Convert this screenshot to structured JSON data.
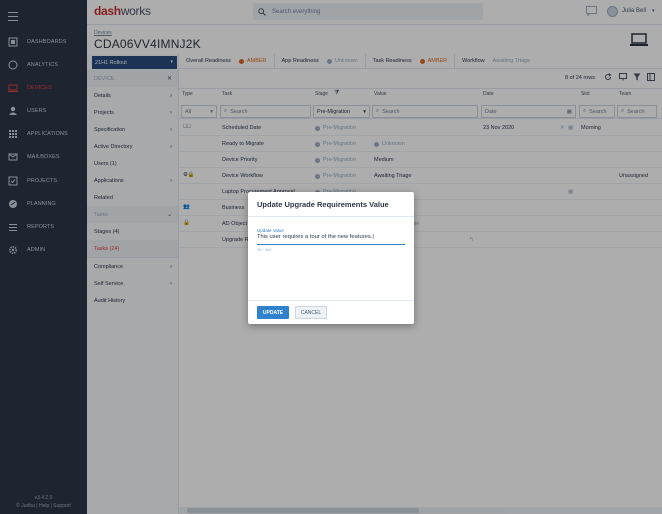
{
  "app": {
    "logo_main": "dash",
    "logo_works": "works"
  },
  "topbar": {
    "search_placeholder": "Search everything",
    "user_name": "Julia Bell"
  },
  "nav": {
    "items": [
      {
        "label": "DASHBOARDS",
        "icon": "dashboard-icon"
      },
      {
        "label": "ANALYTICS",
        "icon": "analytics-icon"
      },
      {
        "label": "DEVICES",
        "icon": "devices-icon"
      },
      {
        "label": "USERS",
        "icon": "user-icon"
      },
      {
        "label": "APPLICATIONS",
        "icon": "apps-icon"
      },
      {
        "label": "MAILBOXES",
        "icon": "mail-icon"
      },
      {
        "label": "PROJECTS",
        "icon": "projects-icon"
      },
      {
        "label": "PLANNING",
        "icon": "planning-icon"
      },
      {
        "label": "REPORTS",
        "icon": "reports-icon"
      },
      {
        "label": "ADMIN",
        "icon": "gear-icon"
      }
    ],
    "version": "v3.4.2.0",
    "footer": "© Juriba | Help | Support"
  },
  "header": {
    "breadcrumb": "Devices",
    "title": "CDA06VV4IMNJ2K"
  },
  "panel": {
    "rollout": "21H1 Rollout",
    "device_header": "DEVICE",
    "items": [
      {
        "label": "Details",
        "arrow": "›"
      },
      {
        "label": "Projects",
        "arrow": "›"
      },
      {
        "label": "Specification",
        "arrow": "›"
      },
      {
        "label": "Active Directory",
        "arrow": "›"
      },
      {
        "label": "Users (1)",
        "arrow": ""
      },
      {
        "label": "Applications",
        "arrow": "›"
      },
      {
        "label": "Related",
        "arrow": ""
      }
    ],
    "tasks_header": "Tasks",
    "task_items": [
      {
        "label": "Stages (4)",
        "arrow": ""
      },
      {
        "label": "Tasks (24)",
        "arrow": ""
      },
      {
        "label": "Compliance",
        "arrow": "›"
      },
      {
        "label": "Self Service",
        "arrow": "›"
      },
      {
        "label": "Audit History",
        "arrow": ""
      }
    ]
  },
  "readiness": {
    "overall_label": "Overall Readiness",
    "overall_status": "AMBER",
    "app_label": "App Readiness",
    "app_status": "Unknown",
    "task_label": "Task Readiness",
    "task_status": "AMBER",
    "workflow_label": "Workflow",
    "workflow_status": "Awaiting Triage"
  },
  "table": {
    "row_count": "8 of 24 rows",
    "columns": {
      "type": "Type",
      "task": "Task",
      "stage": "Stage",
      "value": "Value",
      "date": "Date",
      "slot": "Slot",
      "team": "Team"
    },
    "filters": {
      "type": "All",
      "task": "Search",
      "stage": "Pre-Migration",
      "value": "Search",
      "date": "Date",
      "slot": "Search",
      "team": "Search"
    },
    "rows": [
      {
        "task": "Scheduled Date",
        "stage": "Pre-Migration",
        "value": "",
        "date": "23 Nov 2020",
        "slot": "Morning",
        "team": ""
      },
      {
        "task": "Ready to Migrate",
        "stage": "Pre-Migration",
        "value": "Unknown",
        "date": "",
        "slot": "",
        "team": ""
      },
      {
        "task": "Device Priority",
        "stage": "Pre-Migration",
        "value": "Medium",
        "date": "",
        "slot": "",
        "team": ""
      },
      {
        "task": "Device Workflow",
        "stage": "Pre-Migration",
        "value": "Awaiting Triage",
        "date": "",
        "slot": "",
        "team": "Unassigned"
      },
      {
        "task": "Laptop Procurement Approval",
        "stage": "Pre-Migration",
        "value": "",
        "date": "",
        "slot": "",
        "team": ""
      },
      {
        "task": "Business",
        "stage": "",
        "value": "",
        "date": "",
        "slot": "",
        "team": ""
      },
      {
        "task": "AD Object",
        "stage": "",
        "value": "ble",
        "date": "",
        "slot": "",
        "team": ""
      },
      {
        "task": "Upgrade R",
        "stage": "",
        "value": "",
        "date": "",
        "slot": "",
        "team": ""
      }
    ]
  },
  "dialog": {
    "title": "Update Upgrade Requirements Value",
    "field_label": "Update Value",
    "field_value": "This user requires a tour of the new features.",
    "char_count": "46 / 400",
    "update_label": "UPDATE",
    "cancel_label": "CANCEL"
  },
  "colors": {
    "accent": "#3182ce",
    "danger": "#e53e3e",
    "amber": "#dd6b20",
    "nav_bg": "#2d3748"
  }
}
